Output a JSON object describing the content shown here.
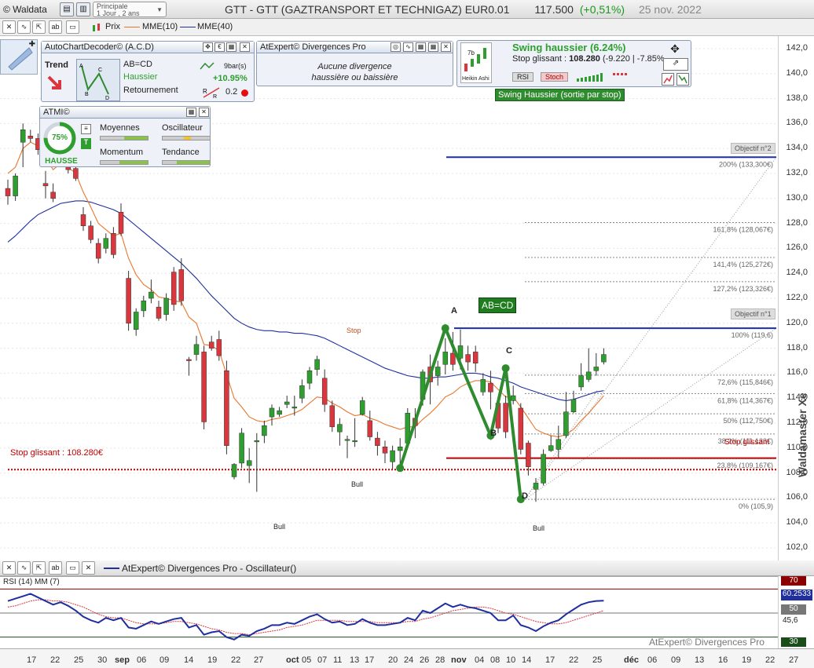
{
  "app": {
    "brand": "© Waldata",
    "selector_line1": "Principale",
    "selector_line2": "1 Jour , 2 ans"
  },
  "header": {
    "title": "GTT - GTT (GAZTRANSPORT ET TECHNIGAZ) EUR0.01",
    "price": "117.500",
    "change": "(+0,51%)",
    "date": "25 nov. 2022"
  },
  "toolbar": {
    "legend_prix": "Prix",
    "legend_mme10": "MME(10)",
    "legend_mme40": "MME(40)"
  },
  "panels": {
    "acd": {
      "title": "AutoChartDecoder© (A.C.D)",
      "trend_label": "Trend",
      "pattern": "AB=CD",
      "direction": "Haussier",
      "type": "Retournement",
      "bars": "9bar(s)",
      "perf": "+10.95%",
      "score": "0.2"
    },
    "divergences": {
      "title": "AtExpert© Divergences Pro",
      "line1": "Aucune divergence",
      "line2": "haussière ou baissière"
    },
    "swing": {
      "title": "Swing haussier (6.24%)",
      "stop_label": "Stop glissant :",
      "stop_value": "108.280",
      "stop_delta": "(-9.220 | -7.85%",
      "rsi": "RSI",
      "stoch": "Stoch",
      "heikin": "Heikin Ashi",
      "tag": "Swing Haussier (sortie par stop)",
      "count": "7b"
    },
    "atmi": {
      "title": "ATMI©",
      "pct": "75%",
      "state": "HAUSSE",
      "moyennes": "Moyennes",
      "oscillateur": "Oscillateur",
      "momentum": "Momentum",
      "tendance": "Tendance"
    }
  },
  "annotations": {
    "abcd": "AB=CD",
    "A": "A",
    "B": "B",
    "C": "C",
    "D": "D",
    "stop_glissant_left": "Stop glissant : 108.280€",
    "stop_glissant_right": "Stop glissant",
    "objectif2": "Objectif n°2",
    "objectif1": "Objectif n°1",
    "stop_marker": "Stop",
    "bull": "Bull"
  },
  "fib_levels": [
    {
      "label": "200% (133,300€)",
      "price": 133.3
    },
    {
      "label": "161,8% (128,067€)",
      "price": 128.067
    },
    {
      "label": "141,4% (125,272€)",
      "price": 125.272
    },
    {
      "label": "127,2% (123,326€)",
      "price": 123.326
    },
    {
      "label": "100% (119,6)",
      "price": 119.6
    },
    {
      "label": "72,6% (115,846€)",
      "price": 115.846
    },
    {
      "label": "61,8% (114,367€)",
      "price": 114.367
    },
    {
      "label": "50% (112,750€)",
      "price": 112.75
    },
    {
      "label": "38,2% (111,133€)",
      "price": 111.133
    },
    {
      "label": "23,8% (109,167€)",
      "price": 109.167
    },
    {
      "label": "0% (105,9)",
      "price": 105.9
    }
  ],
  "y_ticks": [
    "142,0",
    "140,0",
    "138,0",
    "136,0",
    "134,0",
    "132,0",
    "130,0",
    "128,0",
    "126,0",
    "124,0",
    "122,0",
    "120,0",
    "118,0",
    "116,0",
    "114,0",
    "112,0",
    "110,0",
    "108,0",
    "106,0",
    "104,0",
    "102,0"
  ],
  "x_ticks": [
    "17",
    "22",
    "25",
    "30",
    "sep",
    "06",
    "09",
    "14",
    "19",
    "22",
    "27",
    "oct",
    "05",
    "07",
    "11",
    "13",
    "17",
    "20",
    "24",
    "26",
    "28",
    "nov",
    "04",
    "08",
    "10",
    "14",
    "17",
    "22",
    "25",
    "déc",
    "06",
    "09",
    "13",
    "16",
    "19",
    "22",
    "27"
  ],
  "oscillator": {
    "title": "AtExpert© Divergences Pro - Oscillateur()",
    "subtitle": "RSI (14) MM (7)",
    "level70": "70",
    "value": "60.2533",
    "level50": "50",
    "value2": "45,6",
    "level30": "30",
    "watermark": "AtExpert© Divergences Pro"
  },
  "watermark": "Waldamaster Xe",
  "colors": {
    "up": "#2e9e2e",
    "down": "#d9363e",
    "mme10": "#e8772e",
    "mme40": "#1f2f9e",
    "zigzag": "#2e8b2e",
    "stop": "#c00000",
    "objective": "#1a2fb0"
  },
  "chart_data": {
    "type": "candlestick",
    "ylim": [
      101,
      143
    ],
    "candles": [
      [
        130.8,
        131.5,
        129.5,
        130.2
      ],
      [
        130.2,
        132.0,
        129.8,
        131.8
      ],
      [
        134.5,
        136.0,
        132.5,
        135.5
      ],
      [
        135.0,
        135.5,
        134.5,
        134.8
      ],
      [
        134.8,
        135.2,
        133.5,
        133.9
      ],
      [
        131.2,
        132.2,
        130.0,
        131.0
      ],
      [
        130.5,
        131.2,
        129.7,
        130.0
      ],
      [
        134.7,
        135.5,
        134.4,
        135.1
      ],
      [
        134.6,
        134.9,
        132.0,
        132.3
      ],
      [
        132.4,
        132.6,
        131.4,
        131.6
      ],
      [
        128.7,
        129.3,
        127.4,
        127.8
      ],
      [
        127.8,
        128.2,
        126.4,
        126.7
      ],
      [
        126.4,
        126.8,
        124.8,
        125.2
      ],
      [
        126.0,
        127.2,
        125.6,
        126.8
      ],
      [
        127.2,
        127.7,
        125.2,
        125.5
      ],
      [
        128.9,
        129.6,
        127.0,
        127.2
      ],
      [
        123.6,
        124.2,
        119.4,
        120.0
      ],
      [
        119.5,
        121.2,
        119.0,
        120.9
      ],
      [
        121.0,
        122.2,
        120.5,
        121.8
      ],
      [
        122.0,
        123.5,
        121.6,
        122.5
      ],
      [
        121.3,
        121.8,
        120.2,
        120.4
      ],
      [
        120.7,
        122.4,
        120.2,
        122.0
      ],
      [
        124.1,
        124.5,
        121.0,
        121.5
      ],
      [
        124.3,
        125.2,
        121.4,
        121.8
      ],
      [
        117.1,
        117.3,
        115.8,
        117.0
      ],
      [
        117.5,
        119.0,
        117.0,
        118.3
      ],
      [
        117.7,
        118.2,
        111.5,
        112.1
      ],
      [
        118.5,
        119.0,
        117.8,
        118.0
      ],
      [
        118.7,
        119.4,
        117.0,
        117.4
      ],
      [
        116.2,
        117.0,
        109.5,
        110.2
      ],
      [
        107.7,
        108.8,
        107.5,
        108.7
      ],
      [
        108.8,
        111.6,
        108.4,
        111.2
      ],
      [
        108.6,
        110.0,
        107.2,
        109.0
      ],
      [
        110.5,
        111.2,
        106.5,
        110.6
      ],
      [
        111.0,
        112.2,
        110.4,
        111.8
      ],
      [
        112.5,
        113.5,
        111.8,
        113.2
      ],
      [
        112.7,
        113.3,
        112.5,
        113.0
      ],
      [
        113.5,
        114.2,
        113.2,
        113.7
      ],
      [
        113.2,
        114.2,
        112.6,
        113.3
      ],
      [
        114.0,
        115.5,
        113.6,
        115.0
      ],
      [
        115.2,
        116.5,
        114.7,
        116.2
      ],
      [
        116.3,
        117.4,
        115.8,
        117.1
      ],
      [
        115.6,
        116.3,
        112.9,
        113.5
      ],
      [
        113.4,
        113.8,
        111.3,
        111.7
      ],
      [
        111.3,
        112.4,
        110.2,
        111.9
      ],
      [
        110.7,
        111.0,
        109.2,
        110.7
      ],
      [
        110.6,
        112.4,
        110.1,
        110.6
      ],
      [
        112.7,
        114.1,
        112.6,
        113.8
      ],
      [
        112.2,
        113.0,
        110.6,
        110.9
      ],
      [
        110.8,
        111.3,
        109.4,
        110.2
      ],
      [
        110.1,
        110.6,
        108.8,
        109.6
      ],
      [
        108.9,
        110.2,
        108.3,
        109.8
      ],
      [
        109.8,
        110.8,
        108.3,
        110.1
      ],
      [
        110.4,
        113.2,
        110.2,
        112.8
      ],
      [
        112.4,
        113.2,
        110.8,
        111.8
      ],
      [
        113.9,
        116.3,
        113.4,
        116.1
      ],
      [
        116.5,
        117.5,
        113.5,
        115.3
      ],
      [
        115.8,
        117.0,
        115.0,
        116.5
      ],
      [
        116.7,
        118.8,
        115.9,
        117.7
      ],
      [
        117.6,
        119.3,
        116.2,
        116.7
      ],
      [
        117.2,
        119.5,
        116.3,
        118.2
      ],
      [
        117.5,
        118.2,
        116.2,
        116.9
      ],
      [
        117.7,
        118.2,
        116.1,
        116.8
      ],
      [
        114.5,
        116.0,
        114.2,
        115.5
      ],
      [
        115.2,
        116.2,
        113.1,
        114.5
      ],
      [
        113.6,
        113.9,
        111.2,
        111.6
      ],
      [
        113.6,
        114.2,
        110.8,
        111.3
      ],
      [
        113.8,
        115.0,
        113.5,
        114.2
      ],
      [
        113.2,
        113.6,
        109.5,
        109.9
      ],
      [
        110.4,
        110.6,
        107.8,
        108.5
      ],
      [
        106.7,
        107.6,
        105.7,
        107.2
      ],
      [
        107.2,
        109.9,
        107.0,
        109.5
      ],
      [
        109.8,
        111.0,
        109.7,
        110.2
      ],
      [
        109.9,
        111.8,
        109.2,
        110.7
      ],
      [
        111.0,
        114.5,
        110.8,
        112.9
      ],
      [
        112.9,
        114.6,
        112.8,
        113.9
      ],
      [
        114.9,
        116.8,
        114.6,
        115.8
      ],
      [
        115.5,
        118.0,
        115.3,
        116.1
      ],
      [
        116.2,
        117.6,
        115.8,
        116.5
      ],
      [
        116.9,
        118.0,
        116.7,
        117.5
      ]
    ],
    "mme10": [
      132.0,
      132.5,
      134.0,
      134.5,
      134.2,
      133.3,
      132.3,
      132.8,
      132.5,
      132.0,
      130.5,
      129.3,
      128.0,
      127.5,
      127.0,
      127.2,
      125.2,
      123.9,
      123.1,
      122.7,
      122.1,
      122.0,
      121.8,
      121.7,
      120.5,
      120.0,
      118.3,
      118.2,
      117.8,
      115.9,
      114.0,
      113.3,
      112.5,
      112.2,
      112.1,
      112.3,
      112.4,
      112.6,
      112.8,
      113.1,
      113.6,
      114.1,
      114.0,
      113.6,
      113.3,
      112.9,
      112.6,
      112.7,
      112.4,
      112.2,
      111.9,
      111.7,
      111.5,
      111.7,
      111.7,
      112.3,
      112.8,
      113.4,
      114.1,
      114.4,
      114.9,
      115.2,
      115.4,
      115.4,
      115.3,
      114.7,
      114.1,
      114.1,
      113.3,
      112.4,
      111.5,
      111.2,
      111.0,
      110.9,
      111.1,
      111.5,
      112.2,
      112.8,
      113.5,
      114.2
    ],
    "mme40": [
      126.5,
      127.0,
      127.6,
      128.2,
      128.7,
      129.0,
      129.3,
      129.6,
      129.7,
      129.8,
      129.8,
      129.7,
      129.5,
      129.3,
      129.1,
      128.8,
      128.3,
      127.8,
      127.3,
      126.8,
      126.3,
      125.8,
      125.3,
      124.8,
      124.2,
      123.6,
      122.9,
      122.2,
      121.6,
      121.0,
      120.4,
      120.0,
      119.7,
      119.5,
      119.4,
      119.4,
      119.3,
      119.3,
      119.2,
      119.2,
      119.1,
      119.0,
      118.8,
      118.5,
      118.2,
      117.9,
      117.6,
      117.3,
      117.0,
      116.7,
      116.4,
      116.2,
      116.0,
      115.8,
      115.7,
      115.6,
      115.6,
      115.7,
      115.7,
      115.8,
      115.9,
      116.0,
      116.0,
      115.9,
      115.7,
      115.6,
      115.4,
      115.2,
      114.9,
      114.7,
      114.5,
      114.3,
      114.1,
      113.9,
      113.8,
      113.9,
      114.1,
      114.3,
      114.5,
      114.6
    ],
    "zigzag": [
      {
        "label": "",
        "x": 52,
        "y": 108.4
      },
      {
        "label": "A",
        "x": 58,
        "y": 119.6
      },
      {
        "label": "B",
        "x": 64,
        "y": 111.0
      },
      {
        "label": "C",
        "x": 66,
        "y": 116.4
      },
      {
        "label": "D",
        "x": 68,
        "y": 105.9
      }
    ],
    "stop_glissant": 108.28,
    "stop_red": 109.2,
    "objectif1": 119.6,
    "objectif2": 133.3,
    "rsi": [
      60,
      62,
      64,
      66,
      63,
      60,
      57,
      59,
      56,
      52,
      47,
      44,
      42,
      46,
      44,
      46,
      38,
      37,
      40,
      43,
      41,
      43,
      45,
      46,
      38,
      40,
      32,
      34,
      35,
      30,
      28,
      32,
      31,
      35,
      37,
      40,
      40,
      42,
      41,
      44,
      47,
      49,
      45,
      42,
      43,
      40,
      41,
      45,
      42,
      40,
      40,
      41,
      42,
      46,
      44,
      52,
      50,
      54,
      58,
      55,
      57,
      55,
      54,
      52,
      50,
      44,
      44,
      48,
      40,
      38,
      35,
      39,
      42,
      44,
      49,
      53,
      57,
      59,
      60,
      60.25
    ],
    "rsi_ma": [
      55,
      56,
      58,
      60,
      61,
      61,
      60,
      60,
      59,
      57,
      55,
      52,
      49,
      47,
      46,
      46,
      44,
      42,
      41,
      41,
      41,
      42,
      43,
      43,
      42,
      41,
      39,
      37,
      36,
      34,
      33,
      33,
      32,
      33,
      34,
      35,
      36,
      38,
      39,
      40,
      42,
      44,
      44,
      44,
      44,
      43,
      43,
      43,
      43,
      42,
      42,
      42,
      42,
      43,
      43,
      45,
      46,
      48,
      50,
      52,
      53,
      54,
      55,
      55,
      54,
      52,
      50,
      49,
      47,
      45,
      43,
      42,
      41,
      41,
      42,
      44,
      46,
      48,
      50,
      52
    ],
    "rsi_ylim": [
      20,
      80
    ]
  }
}
